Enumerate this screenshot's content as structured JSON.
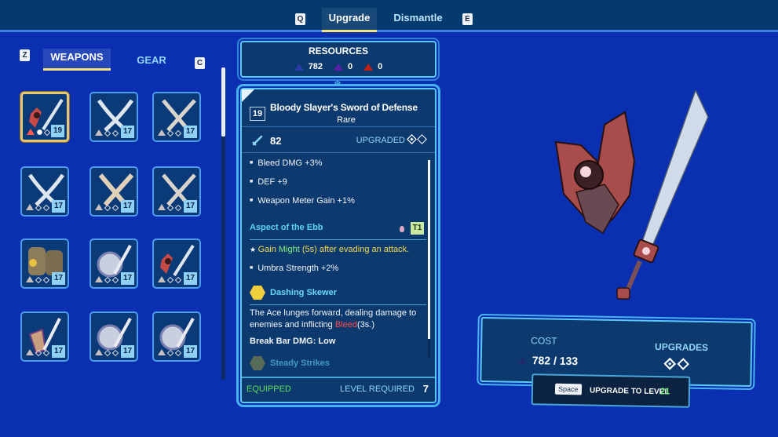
{
  "top_tabs": {
    "left_key": "Q",
    "right_key": "E",
    "tabs": [
      {
        "label": "Upgrade",
        "active": true
      },
      {
        "label": "Dismantle",
        "active": false
      }
    ]
  },
  "sub_tabs": {
    "left_key": "Z",
    "right_key": "C",
    "tabs": [
      {
        "label": "WEAPONS",
        "active": true
      },
      {
        "label": "GEAR",
        "active": false
      }
    ]
  },
  "inventory": {
    "items": [
      {
        "name": "Bloody Slayer's Sword of Defense",
        "icon": "red-sword-shield-icon",
        "level": "19",
        "rarity_marker": "red",
        "upgrades_filled": 1,
        "selected": true
      },
      {
        "name": "Dual daggers",
        "icon": "crossed-daggers-icon",
        "level": "17",
        "rarity_marker": "grey",
        "upgrades_filled": 0,
        "selected": false
      },
      {
        "name": "Crossed knives",
        "icon": "crossed-knives-icon",
        "level": "17",
        "rarity_marker": "grey",
        "upgrades_filled": 0,
        "selected": false
      },
      {
        "name": "Dual daggers",
        "icon": "crossed-daggers-icon",
        "level": "17",
        "rarity_marker": "grey",
        "upgrades_filled": 0,
        "selected": false
      },
      {
        "name": "Golden dual blades",
        "icon": "crossed-blades-icon",
        "level": "17",
        "rarity_marker": "grey",
        "upgrades_filled": 0,
        "selected": false
      },
      {
        "name": "Crossed knives",
        "icon": "crossed-knives-icon",
        "level": "17",
        "rarity_marker": "grey",
        "upgrades_filled": 0,
        "selected": false
      },
      {
        "name": "Stone gauntlets",
        "icon": "stone-gauntlets-icon",
        "level": "17",
        "rarity_marker": "grey",
        "upgrades_filled": 0,
        "selected": false
      },
      {
        "name": "Round shield and sword",
        "icon": "round-shield-sword-icon",
        "level": "17",
        "rarity_marker": "grey",
        "upgrades_filled": 0,
        "selected": false
      },
      {
        "name": "Red sword and shield",
        "icon": "red-sword-shield-icon",
        "level": "17",
        "rarity_marker": "grey",
        "upgrades_filled": 0,
        "selected": false
      },
      {
        "name": "Purple shield and sword",
        "icon": "purple-shield-sword-icon",
        "level": "17",
        "rarity_marker": "grey",
        "upgrades_filled": 0,
        "selected": false
      },
      {
        "name": "Round shield and sword",
        "icon": "round-shield-sword-icon",
        "level": "17",
        "rarity_marker": "grey",
        "upgrades_filled": 0,
        "selected": false
      },
      {
        "name": "Round shield and sword",
        "icon": "round-shield-sword-icon",
        "level": "17",
        "rarity_marker": "grey",
        "upgrades_filled": 0,
        "selected": false
      }
    ],
    "scroll_fraction_visible": 0.22
  },
  "resources": {
    "title": "RESOURCES",
    "items": [
      {
        "icon": "blue-ore-icon",
        "value": "782"
      },
      {
        "icon": "purple-ore-icon",
        "value": "0"
      },
      {
        "icon": "red-ore-icon",
        "value": "0"
      }
    ]
  },
  "item": {
    "level": "19",
    "name": "Bloody Slayer's Sword of Defense",
    "rarity": "Rare",
    "attack": "82",
    "upgraded_label": "UPGRADED",
    "upgrades_filled": 1,
    "upgrades_total": 2,
    "stats": [
      "Bleed DMG +3%",
      "DEF +9",
      "Weapon Meter Gain +1%"
    ],
    "aspect": {
      "name": "Aspect of the Ebb",
      "tier": "T1",
      "perk_prefix": "Gain ",
      "perk_highlight": "Might",
      "perk_suffix": " (5s) after evading an attack.",
      "stat": "Umbra Strength +2%"
    },
    "skills": [
      {
        "name": "Dashing Skewer",
        "desc_before": "The Ace lunges forward, dealing damage to enemies and inflicting ",
        "desc_highlight": "Bleed",
        "desc_after": "(3s.)",
        "break_bar": "Break Bar DMG: Low"
      },
      {
        "name": "Steady Strikes"
      }
    ],
    "equipped_label": "EQUIPPED",
    "level_required_label": "LEVEL REQUIRED",
    "level_required": "7"
  },
  "cost": {
    "label": "COST",
    "value": "782 / 133",
    "upgrades_label": "UPGRADES",
    "upgrades_filled": 1,
    "upgrades_total": 2
  },
  "action": {
    "key": "Space",
    "label": "UPGRADE TO LEVEL",
    "level": "21"
  },
  "colors": {
    "background": "#0a2fb0",
    "panel": "#0d3a6e",
    "accent": "#5cc8f5",
    "gold": "#e7c874",
    "green": "#7ff07a",
    "bleed": "#ff4a4a"
  }
}
